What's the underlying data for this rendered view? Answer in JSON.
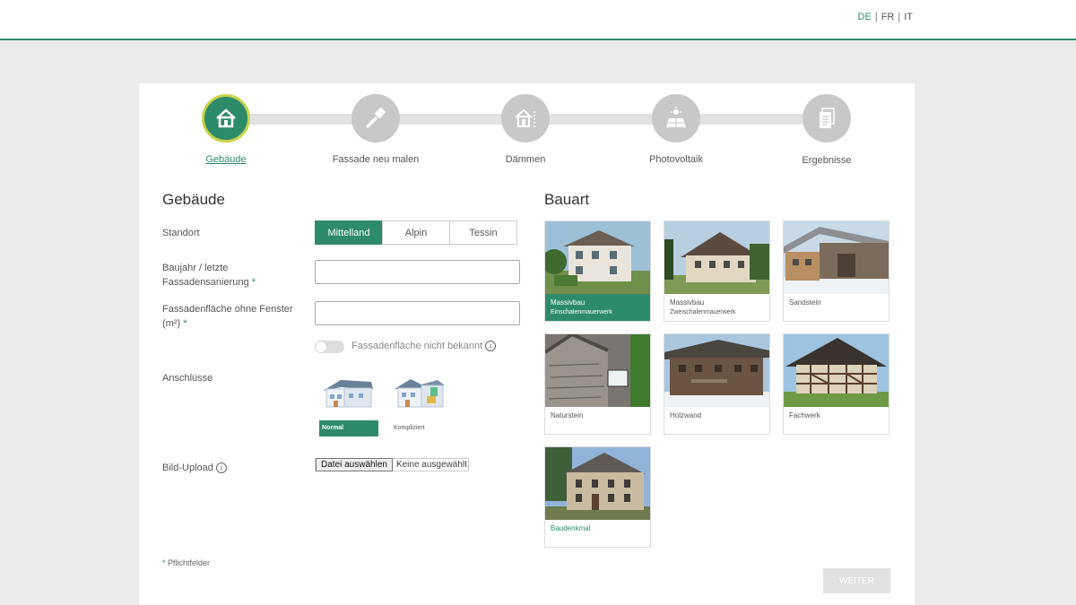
{
  "header": {
    "languages": [
      {
        "code": "DE",
        "active": true
      },
      {
        "code": "FR",
        "active": false
      },
      {
        "code": "IT",
        "active": false
      }
    ],
    "separator": "|"
  },
  "stepper": {
    "steps": [
      {
        "label": "Gebäude",
        "icon": "house-icon",
        "active": true
      },
      {
        "label": "Fassade neu malen",
        "icon": "paintbrush-icon",
        "active": false
      },
      {
        "label": "Dämmen",
        "icon": "insulation-house-icon",
        "active": false
      },
      {
        "label": "Photovoltaik",
        "icon": "solar-panel-icon",
        "active": false
      },
      {
        "label": "Ergebnisse",
        "icon": "documents-icon",
        "active": false
      }
    ]
  },
  "form": {
    "title": "Gebäude",
    "standort_label": "Standort",
    "standort_options": [
      "Mittelland",
      "Alpin",
      "Tessin"
    ],
    "standort_selected": "Mittelland",
    "baujahr_label": "Baujahr / letzte Fassadensanierung",
    "baujahr_value": "",
    "flaeche_label": "Fassadenfläche ohne Fenster (m²)",
    "flaeche_value": "",
    "required_mark": "*",
    "unknown_toggle_label": "Fassadenfläche nicht bekannt",
    "unknown_toggle_on": false,
    "anschluesse_label": "Anschlüsse",
    "anschluesse_options": [
      {
        "label": "Normal",
        "selected": true
      },
      {
        "label": "Kompliziert",
        "selected": false
      }
    ],
    "upload_label": "Bild-Upload",
    "upload_button": "Datei auswählen",
    "upload_filename": "Keine ausgewählt",
    "footnote": "Pflichtfelder",
    "next_button": "WEITER"
  },
  "bauart": {
    "title": "Bauart",
    "tiles": [
      {
        "label": "Massivbau",
        "sub": "Einschalenmauerwerk",
        "selected": true
      },
      {
        "label": "Massivbau",
        "sub": "Zweischalenmauerwerk",
        "selected": false
      },
      {
        "label": "Sandstein",
        "sub": "",
        "selected": false
      },
      {
        "label": "Naturstein",
        "sub": "",
        "selected": false
      },
      {
        "label": "Holzwand",
        "sub": "",
        "selected": false
      },
      {
        "label": "Fachwerk",
        "sub": "",
        "selected": false
      },
      {
        "label": "Baudenkmal",
        "sub": "",
        "selected": false
      }
    ]
  },
  "colors": {
    "accent": "#2e8b6a",
    "step_inactive": "#c8c8c8",
    "active_ring": "#c9d34a"
  }
}
